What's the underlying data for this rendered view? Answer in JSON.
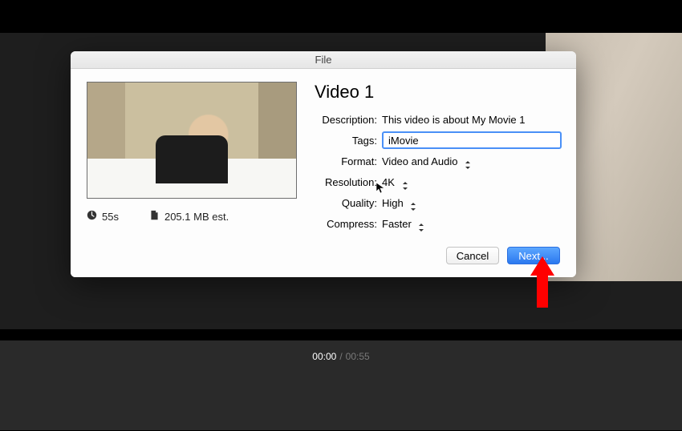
{
  "dialog": {
    "title": "File",
    "heading": "Video 1",
    "fields": {
      "description": {
        "label": "Description:",
        "value": "This video is about My Movie 1"
      },
      "tags": {
        "label": "Tags:",
        "value": "iMovie"
      },
      "format": {
        "label": "Format:",
        "value": "Video and Audio"
      },
      "resolution": {
        "label": "Resolution:",
        "value": "4K"
      },
      "quality": {
        "label": "Quality:",
        "value": "High"
      },
      "compress": {
        "label": "Compress:",
        "value": "Faster"
      }
    },
    "meta": {
      "duration": "55s",
      "size": "205.1 MB est."
    },
    "buttons": {
      "cancel": "Cancel",
      "next": "Next..."
    }
  },
  "timeline": {
    "current": "00:00",
    "total": "00:55"
  }
}
